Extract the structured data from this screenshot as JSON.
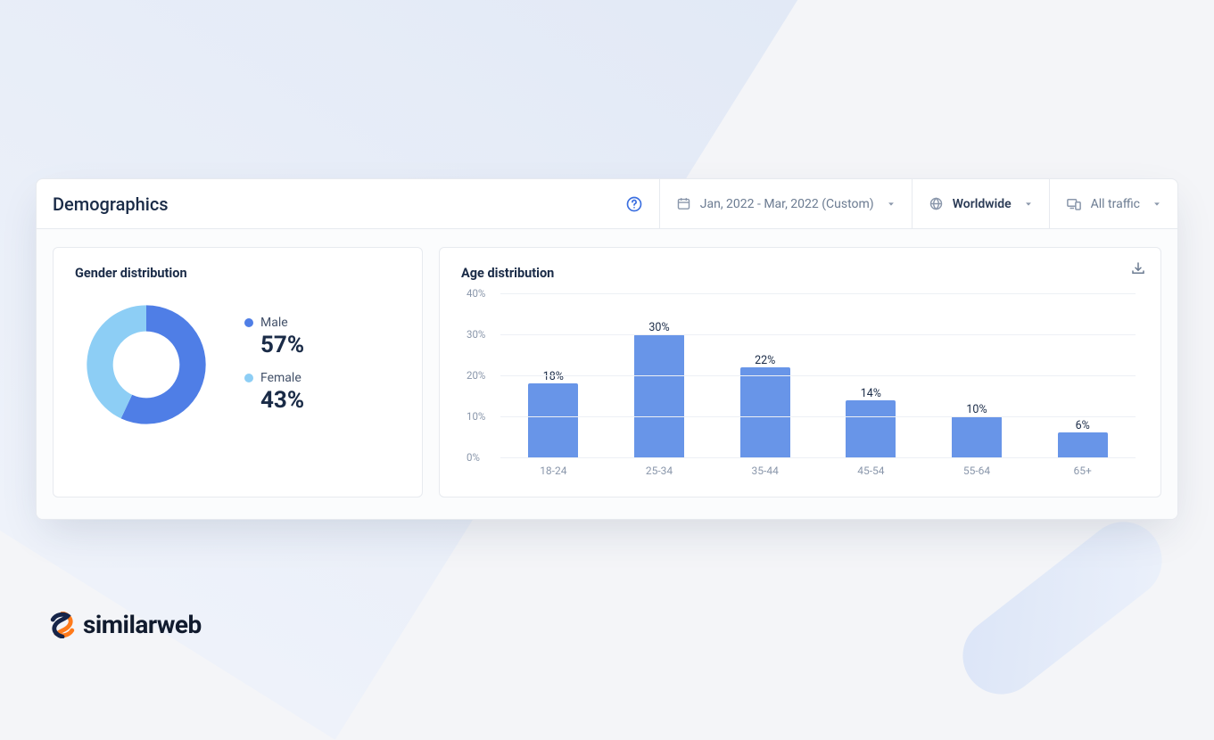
{
  "header": {
    "title": "Demographics",
    "date_range": "Jan, 2022 - Mar, 2022 (Custom)",
    "region": "Worldwide",
    "traffic": "All traffic"
  },
  "gender_card": {
    "title": "Gender distribution",
    "series": [
      {
        "name": "Male",
        "value": 57,
        "display": "57%",
        "color": "#4f7ee6"
      },
      {
        "name": "Female",
        "value": 43,
        "display": "43%",
        "color": "#8dcef5"
      }
    ]
  },
  "age_card": {
    "title": "Age distribution"
  },
  "brand": "similarweb",
  "chart_data": [
    {
      "type": "pie",
      "title": "Gender distribution",
      "series": [
        {
          "name": "Male",
          "value": 57
        },
        {
          "name": "Female",
          "value": 43
        }
      ]
    },
    {
      "type": "bar",
      "title": "Age distribution",
      "categories": [
        "18-24",
        "25-34",
        "35-44",
        "45-54",
        "55-64",
        "65+"
      ],
      "values": [
        18,
        30,
        22,
        14,
        10,
        6
      ],
      "ylabel": "",
      "xlabel": "",
      "ylim": [
        0,
        40
      ],
      "y_ticks": [
        0,
        10,
        20,
        30,
        40
      ],
      "bar_color": "#6895e8",
      "value_suffix": "%"
    }
  ]
}
